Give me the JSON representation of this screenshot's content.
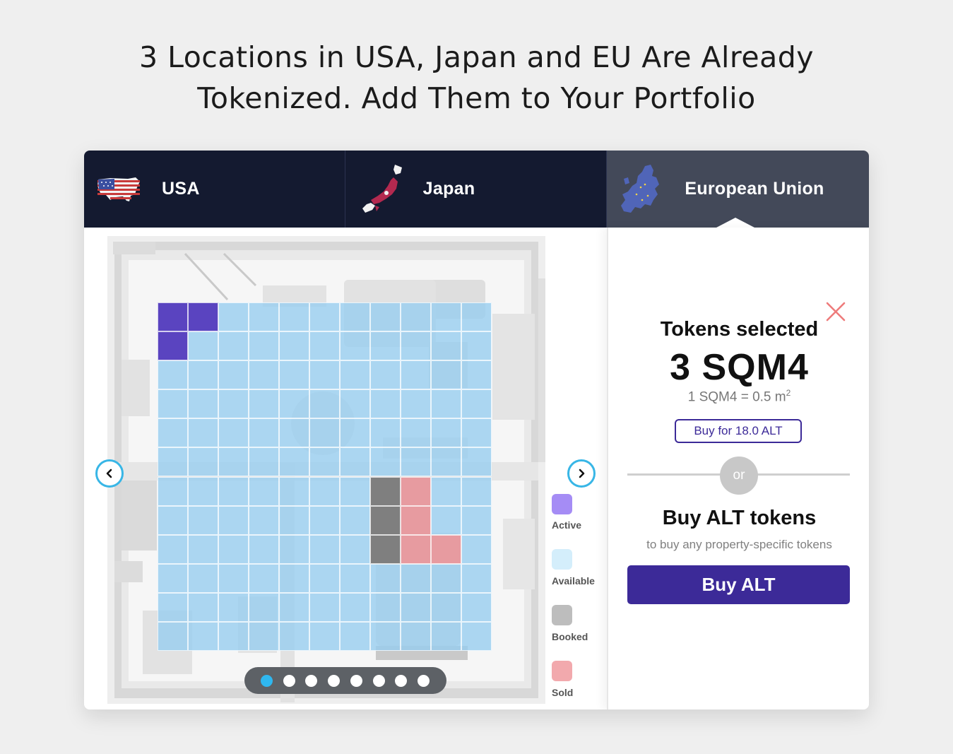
{
  "headline": {
    "line1": "3 Locations in USA, Japan and EU Are Already",
    "line2": "Tokenized. Add Them to Your Portfolio"
  },
  "tabs": [
    {
      "label": "USA",
      "icon": "usa-map-icon"
    },
    {
      "label": "Japan",
      "icon": "japan-map-icon"
    },
    {
      "label": "European Union",
      "icon": "eu-map-icon",
      "selected": true
    }
  ],
  "colors": {
    "tab_bg": "#141a30",
    "tab_selected_bg": "#434959",
    "accent_purple": "#3c2a98",
    "arrow_ring": "#38b6e6",
    "active": "#5a44c0",
    "available": "#a8d9f6",
    "booked": "#7f7f7f",
    "sold": "#e79ba0"
  },
  "legend": [
    {
      "key": "active",
      "label": "Active",
      "color": "#a58cf5"
    },
    {
      "key": "available",
      "label": "Available",
      "color": "#d4eefb"
    },
    {
      "key": "booked",
      "label": "Booked",
      "color": "#bdbdbd"
    },
    {
      "key": "sold",
      "label": "Sold",
      "color": "#f2a9ad"
    }
  ],
  "carousel": {
    "dots": 8,
    "active_index": 0
  },
  "grid": {
    "cols": 11,
    "rows": 12,
    "active": [
      [
        0,
        0
      ],
      [
        0,
        1
      ],
      [
        1,
        0
      ]
    ],
    "booked": [
      [
        6,
        7
      ],
      [
        7,
        7
      ],
      [
        8,
        7
      ]
    ],
    "sold": [
      [
        6,
        8
      ],
      [
        7,
        8
      ],
      [
        8,
        8
      ],
      [
        8,
        9
      ]
    ]
  },
  "panel": {
    "title": "Tokens selected",
    "amount": "3 SQM4",
    "rate_text": "1 SQM4 = 0.5 m",
    "rate_sup": "2",
    "buy_for_label": "Buy for 18.0 ALT",
    "or_label": "or",
    "buy_alt_title": "Buy ALT tokens",
    "buy_alt_subtitle": "to buy any property-specific tokens",
    "buy_alt_button": "Buy ALT"
  }
}
